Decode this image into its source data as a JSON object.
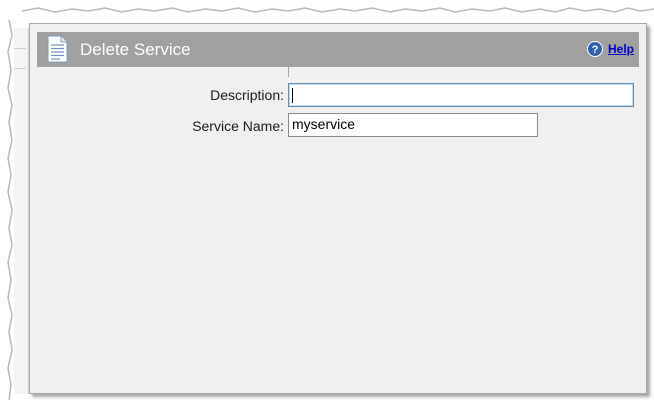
{
  "panel": {
    "title": "Delete Service",
    "help_label": "Help"
  },
  "form": {
    "description": {
      "label": "Description:",
      "value": ""
    },
    "service_name": {
      "label": "Service Name:",
      "value": "myservice"
    }
  },
  "icons": {
    "title_icon": "document-icon",
    "help_icon": "help-icon"
  },
  "colors": {
    "titlebar": "#a0a0a0",
    "panel_bg": "#f0f0f0",
    "help_link": "#0000cc",
    "focus_border": "#5b8fb5"
  }
}
